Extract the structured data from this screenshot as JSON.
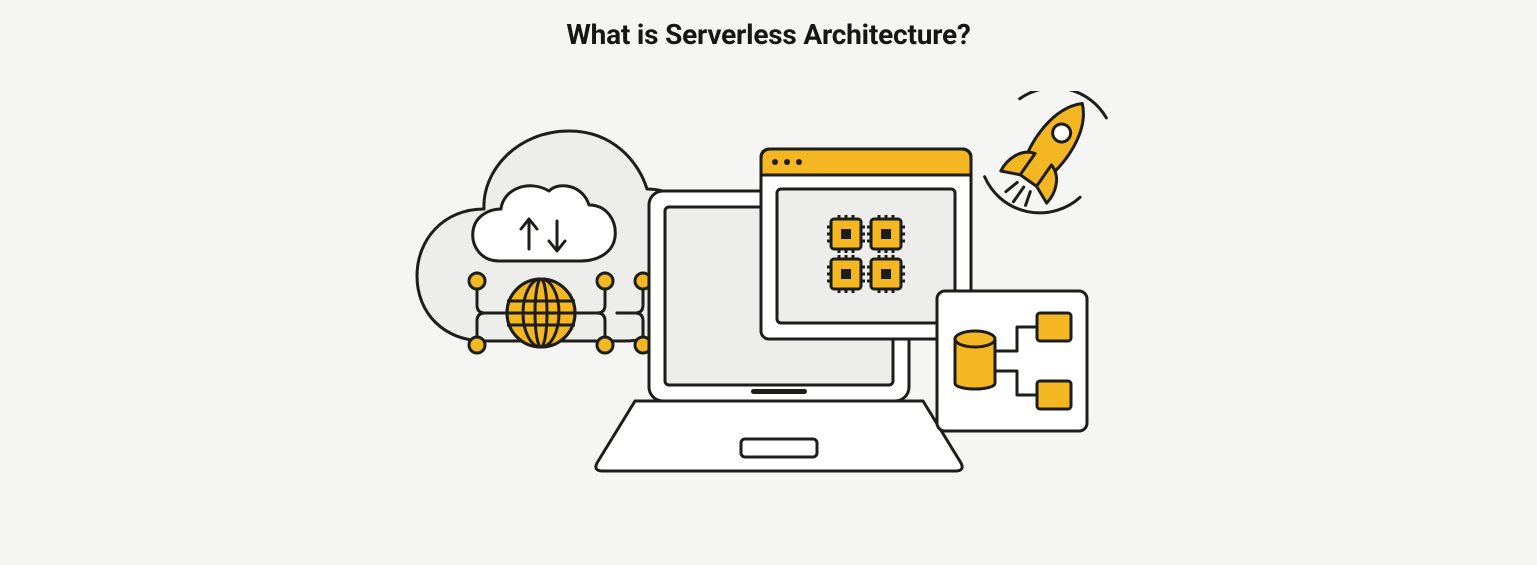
{
  "heading": "What is Serverless Architecture?",
  "palette": {
    "stroke": "#1d1d1b",
    "accent": "#f4b721",
    "panel_light": "#ededeb",
    "panel_mid": "#dedddb",
    "panel_dark": "#cfcecc",
    "white": "#ffffff",
    "bg": "#f5f5f4"
  },
  "diagram": {
    "elements": [
      "cloud-background",
      "cloud-sync-icon",
      "globe-icon",
      "network-nodes",
      "laptop",
      "browser-window",
      "cpu-chips",
      "database-panel",
      "rocket-icon"
    ]
  }
}
